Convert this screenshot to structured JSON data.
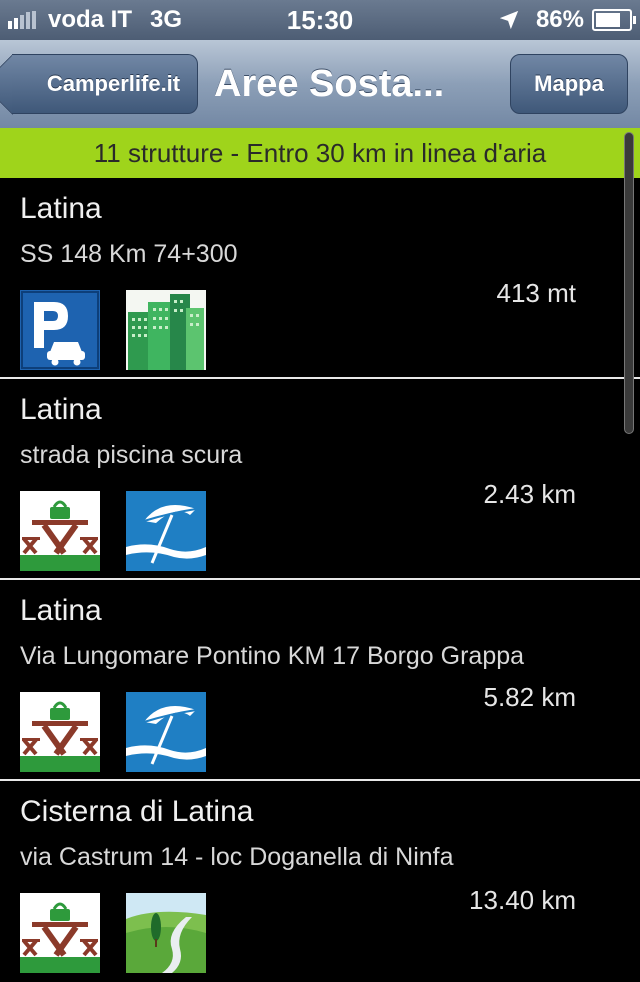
{
  "status_bar": {
    "carrier": "voda IT",
    "network": "3G",
    "time": "15:30",
    "battery": "86%",
    "battery_level": 0.86
  },
  "nav": {
    "back_label": "Camperlife.it",
    "title": "Aree Sosta...",
    "map_label": "Mappa"
  },
  "summary": "11 strutture - Entro 30 km in linea d'aria",
  "rows": [
    {
      "city": "Latina",
      "address": "SS 148 Km 74+300",
      "distance": "413 mt",
      "icons": [
        "parking-icon",
        "city-buildings-icon"
      ]
    },
    {
      "city": "Latina",
      "address": "strada piscina scura",
      "distance": "2.43 km",
      "icons": [
        "picnic-table-icon",
        "beach-umbrella-icon"
      ]
    },
    {
      "city": "Latina",
      "address": "Via Lungomare Pontino KM 17  Borgo Grappa",
      "distance": "5.82 km",
      "icons": [
        "picnic-table-icon",
        "beach-umbrella-icon"
      ]
    },
    {
      "city": "Cisterna di Latina",
      "address": "via Castrum 14 - loc Doganella di Ninfa",
      "distance": "13.40 km",
      "icons": [
        "picnic-table-icon",
        "countryside-icon"
      ]
    }
  ],
  "colors": {
    "accent_green": "#9fd41b",
    "nav_blue": "#7388a4",
    "parking_blue": "#1e63b0"
  }
}
